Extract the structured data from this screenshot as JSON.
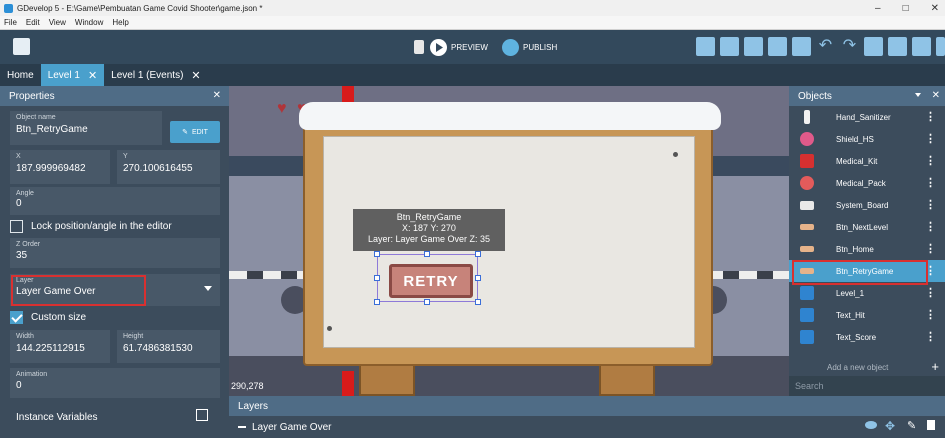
{
  "window": {
    "title": "GDevelop 5 - E:\\Game\\Pembuatan Game Covid Shooter\\game.json *"
  },
  "menu": [
    "File",
    "Edit",
    "View",
    "Window",
    "Help"
  ],
  "toolbar": {
    "preview_label": "PREVIEW",
    "publish_label": "PUBLISH"
  },
  "tabs": [
    {
      "label": "Home",
      "closable": false
    },
    {
      "label": "Level 1",
      "closable": true
    },
    {
      "label": "Level 1 (Events)",
      "closable": true
    }
  ],
  "properties": {
    "title": "Properties",
    "object_name_label": "Object name",
    "object_name_value": "Btn_RetryGame",
    "edit_label": "EDIT",
    "x_label": "X",
    "x_value": "187.999969482",
    "y_label": "Y",
    "y_value": "270.100616455",
    "angle_label": "Angle",
    "angle_value": "0",
    "lock_label": "Lock position/angle in the editor",
    "zorder_label": "Z Order",
    "zorder_value": "35",
    "layer_label": "Layer",
    "layer_value": "Layer Game Over",
    "custom_size_label": "Custom size",
    "width_label": "Width",
    "width_value": "144.225112915",
    "height_label": "Height",
    "height_value": "61.7486381530",
    "animation_label": "Animation",
    "animation_value": "0",
    "instance_vars_label": "Instance Variables"
  },
  "canvas": {
    "tooltip_name": "Btn_RetryGame",
    "tooltip_pos": "X: 187  Y: 270",
    "tooltip_layer": "Layer: Layer Game Over  Z: 35",
    "button_text": "RETRY",
    "cursor_coords": "290,278"
  },
  "layers": {
    "title": "Layers",
    "item": "Layer Game Over"
  },
  "objects": {
    "title": "Objects",
    "items": [
      {
        "name": "Hand_Sanitizer",
        "icon": "bottle-icon",
        "color": "#f2f2f2"
      },
      {
        "name": "Shield_HS",
        "icon": "shield-icon",
        "color": "#e05a8a"
      },
      {
        "name": "Medical_Kit",
        "icon": "medkit-icon",
        "color": "#d63030"
      },
      {
        "name": "Medical_Pack",
        "icon": "medpack-icon",
        "color": "#e35b5b"
      },
      {
        "name": "System_Board",
        "icon": "board-icon",
        "color": "#e9e9e9"
      },
      {
        "name": "Btn_NextLevel",
        "icon": "button-icon",
        "color": "#e6b38a"
      },
      {
        "name": "Btn_Home",
        "icon": "button-icon",
        "color": "#e6b38a"
      },
      {
        "name": "Btn_RetryGame",
        "icon": "button-icon",
        "color": "#e6b38a"
      },
      {
        "name": "Level_1",
        "icon": "text-icon",
        "color": "#2f84d0"
      },
      {
        "name": "Text_Hit",
        "icon": "text-icon",
        "color": "#2f84d0"
      },
      {
        "name": "Text_Score",
        "icon": "text-icon",
        "color": "#2f84d0"
      }
    ],
    "add_label": "Add a new object",
    "search_placeholder": "Search"
  }
}
